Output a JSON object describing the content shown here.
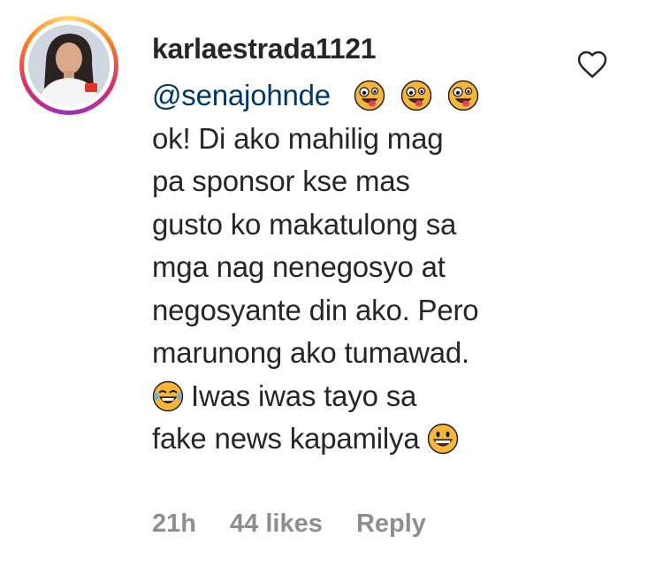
{
  "comment": {
    "username": "karlaestrada1121",
    "mention": "@senajohnde",
    "lines": [
      "ok! Di ako mahilig mag",
      "pa sponsor kse mas",
      "gusto ko makatulong sa",
      "mga nag nenegosyo at",
      "negosyante din ako. Pero",
      "marunong ako tumawad.",
      "Iwas iwas tayo sa",
      "fake news kapamilya"
    ],
    "emojis": {
      "after_mention": [
        "zany-face",
        "zany-face",
        "zany-face"
      ],
      "line_7_prefix": "tears-of-joy-face",
      "line_8_suffix": "grinning-face"
    }
  },
  "meta": {
    "time": "21h",
    "likes": "44 likes",
    "reply_label": "Reply"
  },
  "icons": {
    "like": "heart-outline-icon"
  },
  "colors": {
    "text": "#262626",
    "mention": "#00376b",
    "meta": "#8e8e8e",
    "story_ring": [
      "#feda75",
      "#fa7e1e",
      "#d62976",
      "#962fbf"
    ]
  }
}
